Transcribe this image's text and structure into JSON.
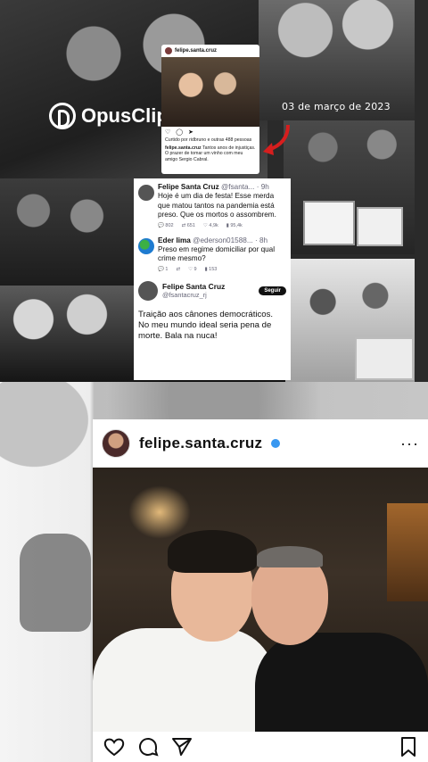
{
  "watermark": {
    "brand": "OpusClip"
  },
  "collage": {
    "date": "03 de março de 2023"
  },
  "mini_instagram": {
    "username": "felipe.santa.cruz",
    "actions": "♡ ◯ ➤",
    "liked_by": "Curtido por ridbruno e outras 488 pessoas",
    "caption_user": "felipe.santa.cruz",
    "caption_text": "Tantos anos de injustiças. O prazer de tomar um vinho com meu amigo Sergio Cabral."
  },
  "tweets": [
    {
      "name": "Felipe Santa Cruz",
      "handle": "@fsanta...",
      "time": "· 9h",
      "text": "Hoje é um dia de festa! Esse merda que matou tantos na pandemia está preso. Que os mortos o assombrem.",
      "metrics": [
        "802",
        "651",
        "4,9k",
        "95,4k"
      ]
    },
    {
      "name": "Eder lima",
      "handle": "@ederson01588...",
      "time": "· 8h",
      "text": "Preso em regime domiciliar por qual crime mesmo?",
      "metrics": [
        "1",
        "",
        "9",
        "153"
      ]
    }
  ],
  "tweet_main": {
    "name": "Felipe Santa Cruz",
    "handle": "@fsantacruz_rj",
    "follow_label": "Seguir",
    "text": "Traição aos cânones democráticos. No meu mundo ideal seria pena de morte. Bala na nuca!"
  },
  "instagram_post": {
    "username": "felipe.santa.cruz",
    "more": "···",
    "icons": [
      "heart-icon",
      "comment-icon",
      "share-icon",
      "bookmark-icon"
    ]
  },
  "colors": {
    "verified": "#3897f0",
    "arrow": "#d61e1e"
  }
}
